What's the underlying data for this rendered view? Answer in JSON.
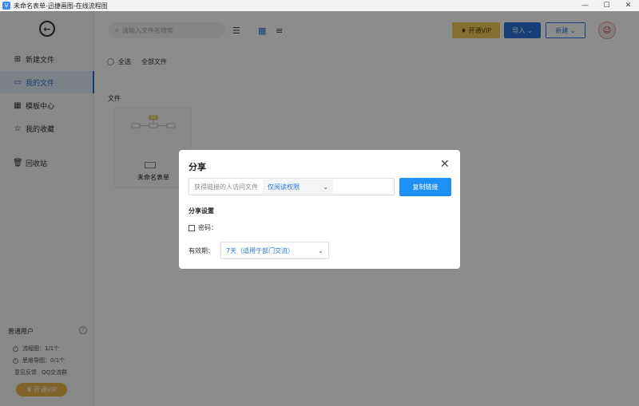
{
  "window": {
    "title": "未命名表单-迅捷画图-在线流程图",
    "logo": "V",
    "minimize": "—",
    "maximize": "☐",
    "close": "✕"
  },
  "sidebar": {
    "back_icon": "←",
    "items": [
      {
        "icon": "⊞",
        "label": "新建文件"
      },
      {
        "icon": "▭",
        "label": "我的文件"
      },
      {
        "icon": "▦",
        "label": "模板中心"
      },
      {
        "icon": "☆",
        "label": "我的收藏"
      },
      {
        "icon": "🗑",
        "label": "回收站"
      }
    ],
    "user_type": "普通用户",
    "help": "?",
    "quota_flow": "流程图：1/1个",
    "quota_mind": "思维导图：0/1个",
    "feedback": "意见反馈",
    "qq_group": "QQ交流群",
    "vip_label": "开通VIP"
  },
  "toolbar": {
    "search_placeholder": "请输入文件名搜索",
    "vip_label": "开通VIP",
    "import_label": "导入",
    "new_label": "新建"
  },
  "content": {
    "select_all": "全选",
    "all_files": "全部文件",
    "section": "文件",
    "files": [
      {
        "name": "未命名表单"
      }
    ]
  },
  "dialog": {
    "title": "分享",
    "close": "✕",
    "link_label": "获得链接的人访问文件",
    "permission": "仅阅读权限",
    "copy_button": "复制链接",
    "settings_title": "分享设置",
    "password_label": "密码：",
    "expire_label": "有效期：",
    "expire_value": "7天（适用于部门交流）"
  },
  "colors": {
    "primary": "#2a74d8",
    "copy_button": "#1e90f2",
    "vip": "#f5cc5a",
    "overlay": "rgba(0,0,0,0.45)"
  }
}
